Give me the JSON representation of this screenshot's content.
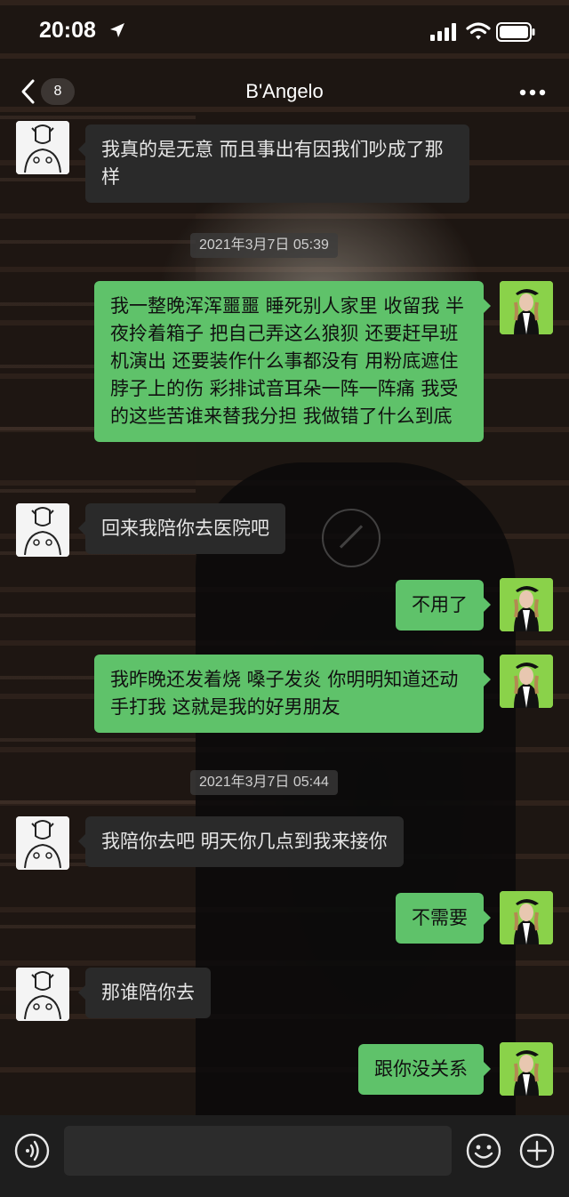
{
  "status_bar": {
    "time": "20:08"
  },
  "nav": {
    "back_count": "8",
    "title": "B'Angelo"
  },
  "messages": [
    {
      "side": "left",
      "text": "我真的是无意 而且事出有因我们吵成了那样"
    },
    {
      "type": "timestamp",
      "text": "2021年3月7日 05:39"
    },
    {
      "side": "right",
      "text": "我一整晚浑浑噩噩 睡死别人家里 收留我 半夜拎着箱子 把自己弄这么狼狈 还要赶早班机演出 还要装作什么事都没有 用粉底遮住脖子上的伤 彩排试音耳朵一阵一阵痛 我受的这些苦谁来替我分担 我做错了什么到底"
    },
    {
      "side": "left",
      "text": "回来我陪你去医院吧"
    },
    {
      "side": "right",
      "text": "不用了"
    },
    {
      "side": "right",
      "text": "我昨晚还发着烧 嗓子发炎 你明明知道还动手打我 这就是我的好男朋友"
    },
    {
      "type": "timestamp",
      "text": "2021年3月7日 05:44"
    },
    {
      "side": "left",
      "text": "我陪你去吧 明天你几点到我来接你"
    },
    {
      "side": "right",
      "text": "不需要"
    },
    {
      "side": "left",
      "text": "那谁陪你去"
    },
    {
      "side": "right",
      "text": "跟你没关系"
    }
  ],
  "input": {
    "value": "",
    "placeholder": ""
  },
  "colors": {
    "sent_bubble": "#5fc26a",
    "received_bubble": "#2a2a2a"
  }
}
